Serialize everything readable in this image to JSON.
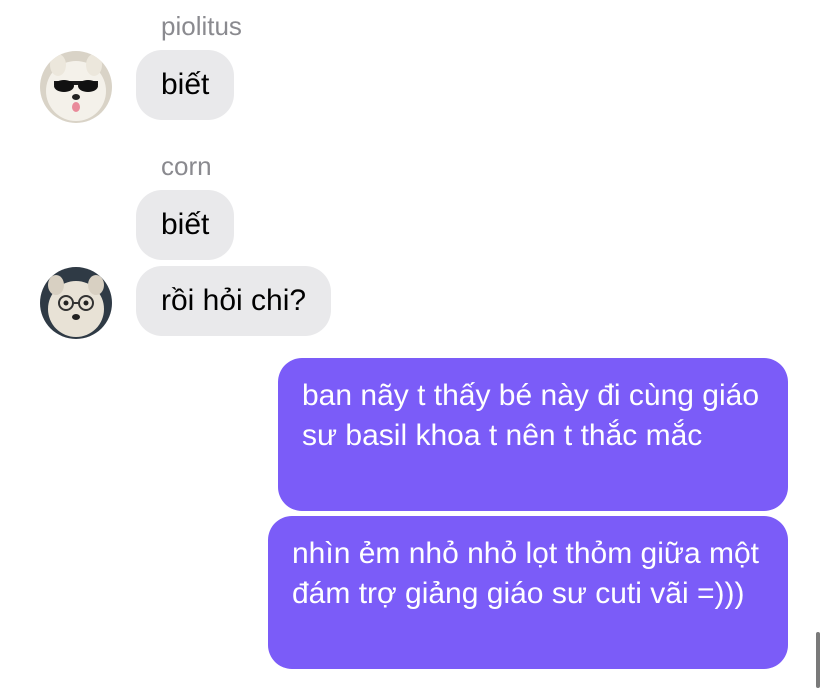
{
  "messages": {
    "group1": {
      "sender": "piolitus",
      "bubbles": [
        "biết"
      ]
    },
    "group2": {
      "sender": "corn",
      "bubbles": [
        "biết",
        "rồi hỏi chi?"
      ]
    },
    "outgoing": [
      "ban nãy t thấy bé này đi cùng giáo sư basil khoa t nên t thắc mắc",
      "nhìn ẻm nhỏ nhỏ lọt thỏm giữa một đám trợ giảng giáo sư cuti vãi =)))"
    ]
  },
  "colors": {
    "outgoing_bubble": "#7b5cf8",
    "incoming_bubble": "#e9e9eb",
    "sender_name": "#8a8a8f"
  },
  "icons": {
    "avatar1": "samoyed-sunglasses-avatar",
    "avatar2": "dog-glasses-avatar"
  }
}
